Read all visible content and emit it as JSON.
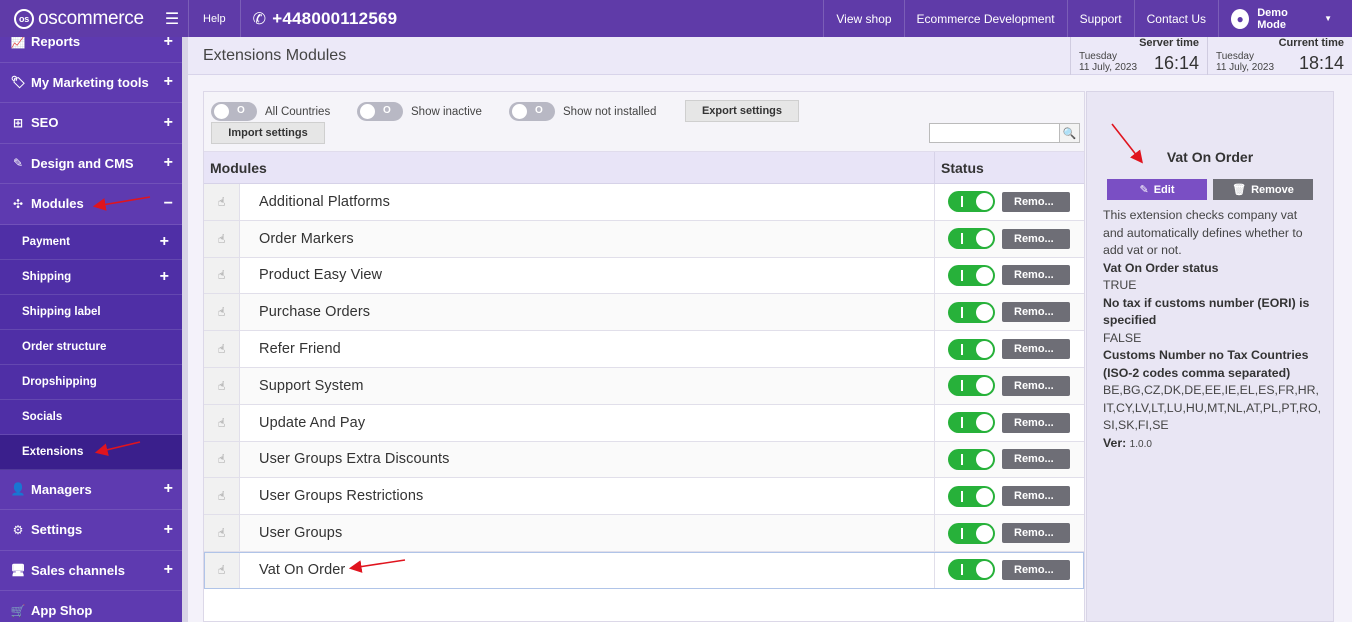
{
  "topbar": {
    "logo": "oscommerce",
    "help": "Help",
    "phone": "+448000112569",
    "links": [
      "View shop",
      "Ecommerce Development",
      "Support",
      "Contact Us"
    ],
    "user": "Demo Mode"
  },
  "sidebar": {
    "items": [
      {
        "label": "Reports",
        "icon": "chart-icon",
        "expand": "+"
      },
      {
        "label": "My Marketing tools",
        "icon": "tag-icon",
        "expand": "+"
      },
      {
        "label": "SEO",
        "icon": "sitemap-icon",
        "expand": "+"
      },
      {
        "label": "Design and CMS",
        "icon": "brush-icon",
        "expand": "+"
      },
      {
        "label": "Modules",
        "icon": "puzzle-icon",
        "expand": "−"
      }
    ],
    "subitems": [
      {
        "label": "Payment",
        "expand": "+"
      },
      {
        "label": "Shipping",
        "expand": "+"
      },
      {
        "label": "Shipping label",
        "expand": ""
      },
      {
        "label": "Order structure",
        "expand": ""
      },
      {
        "label": "Dropshipping",
        "expand": ""
      },
      {
        "label": "Socials",
        "expand": ""
      },
      {
        "label": "Extensions",
        "expand": ""
      }
    ],
    "items_after": [
      {
        "label": "Managers",
        "icon": "user-icon",
        "expand": "+"
      },
      {
        "label": "Settings",
        "icon": "cogs-icon",
        "expand": "+"
      },
      {
        "label": "Sales channels",
        "icon": "monitor-icon",
        "expand": "+"
      },
      {
        "label": "App Shop",
        "icon": "cart-icon",
        "expand": "+"
      }
    ]
  },
  "header": {
    "title": "Extensions Modules",
    "server_time": {
      "label": "Server time",
      "day": "Tuesday",
      "date": "11 July, 2023",
      "time": "16:14"
    },
    "current_time": {
      "label": "Current time",
      "day": "Tuesday",
      "date": "11 July, 2023",
      "time": "18:14"
    }
  },
  "toolbar": {
    "toggles": [
      {
        "label": "All Countries",
        "state": "O"
      },
      {
        "label": "Show inactive",
        "state": "O"
      },
      {
        "label": "Show not installed",
        "state": "O"
      }
    ],
    "export_label": "Export settings",
    "import_label": "Import settings",
    "search_value": ""
  },
  "table": {
    "col_modules": "Modules",
    "col_status": "Status",
    "remove_label": "Remo...",
    "rows": [
      "Additional Platforms",
      "Order Markers",
      "Product Easy View",
      "Purchase Orders",
      "Refer Friend",
      "Support System",
      "Update And Pay",
      "User Groups Extra Discounts",
      "User Groups Restrictions",
      "User Groups",
      "Vat On Order"
    ]
  },
  "panel": {
    "title": "Vat On Order",
    "edit_label": "Edit",
    "remove_label": "Remove",
    "description": "This extension checks company vat and automatically defines whether to add vat or not.",
    "fields": [
      {
        "label": "Vat On Order status",
        "value": "TRUE"
      },
      {
        "label": "No tax if customs number (EORI) is specified",
        "value": "FALSE"
      },
      {
        "label": "Customs Number no Tax Countries (ISO-2 codes comma separated)",
        "value": "BE,BG,CZ,DK,DE,EE,IE,EL,ES,FR,HR,IT,CY,LV,LT,LU,HU,MT,NL,AT,PL,PT,RO,SI,SK,FI,SE"
      }
    ],
    "ver_label": "Ver:",
    "ver_value": "1.0.0"
  },
  "colors": {
    "topbar": "#5f3ba8",
    "sidebar": "#5e3ab0",
    "toggle_on": "#27b13a",
    "annotation": "#e0141e"
  }
}
